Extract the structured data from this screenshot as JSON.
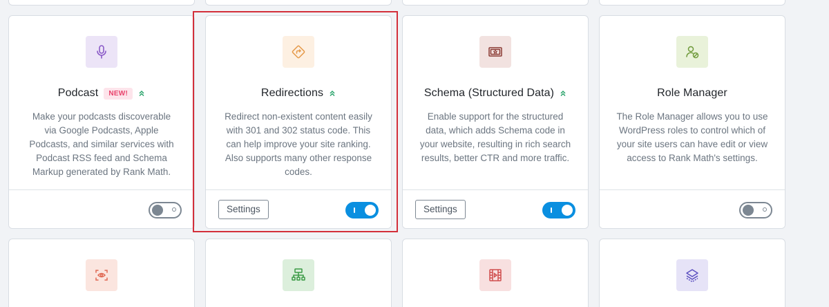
{
  "cards": [
    {
      "title": "Podcast",
      "badge": "NEW!",
      "icon": "microphone-icon",
      "icon_bg": "#ece4f7",
      "icon_color": "#8a5ac7",
      "description": "Make your podcasts discoverable via Google Podcasts, Apple Podcasts, and similar services with Podcast RSS feed and Schema Markup generated by Rank Math.",
      "enabled": false
    },
    {
      "title": "Redirections",
      "icon": "redirect-sign-icon",
      "icon_bg": "#fdf0e2",
      "icon_color": "#e59a4a",
      "description": "Redirect non-existent content easily with 301 and 302 status code. This can help improve your site ranking. Also supports many other response codes.",
      "settings_label": "Settings",
      "enabled": true
    },
    {
      "title": "Schema (Structured Data)",
      "icon": "certificate-icon",
      "icon_bg": "#f2e2e0",
      "icon_color": "#8a3a33",
      "description": "Enable support for the structured data, which adds Schema code in your website, resulting in rich search results, better CTR and more traffic.",
      "settings_label": "Settings",
      "enabled": true
    },
    {
      "title": "Role Manager",
      "icon": "user-check-icon",
      "icon_bg": "#e9f2da",
      "icon_color": "#6f9a3a",
      "description": "The Role Manager allows you to use WordPress roles to control which of your site users can have edit or view access to Rank Math's settings.",
      "enabled": false
    }
  ],
  "bottom_cards": [
    {
      "icon": "eye-scan-icon",
      "icon_bg": "#fbe5df",
      "icon_color": "#e06a55"
    },
    {
      "icon": "sitemap-icon",
      "icon_bg": "#dcefdc",
      "icon_color": "#3a9a45"
    },
    {
      "icon": "video-icon",
      "icon_bg": "#f8e0e0",
      "icon_color": "#cf4d4d"
    },
    {
      "icon": "layers-icon",
      "icon_bg": "#e6e3f7",
      "icon_color": "#5b4fc0"
    }
  ],
  "colors": {
    "toggle_on": "#0a8fe0",
    "highlight": "#d32f3a",
    "chevron": "#2aa36b"
  }
}
